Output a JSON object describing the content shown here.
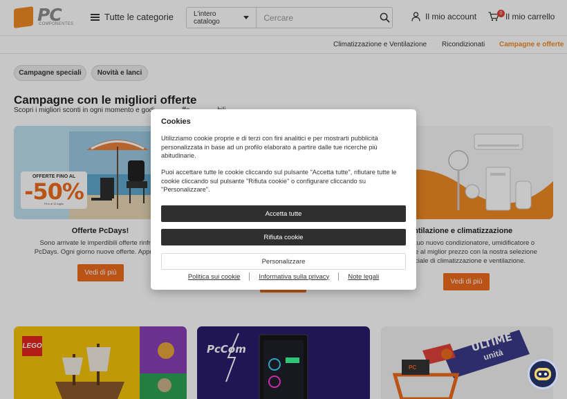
{
  "header": {
    "logo_text": "PC",
    "logo_sub": "COMPONENTES",
    "categories_label": "Tutte le categorie",
    "search": {
      "scope": "L'intero catalogo",
      "placeholder": "Cercare"
    },
    "account_label": "Il mio account",
    "cart_label": "Il mio carrello",
    "cart_count": "0"
  },
  "subnav": {
    "items": [
      {
        "label": "Climatizzazione e Ventilazione"
      },
      {
        "label": "Ricondizionati"
      },
      {
        "label": "Campagne e offerte"
      }
    ]
  },
  "chips": [
    {
      "label": "Campagne speciali"
    },
    {
      "label": "Novità e lanci"
    }
  ],
  "main": {
    "title": "Campagne con le migliori offerte",
    "subtitle": "Scopri i migliori sconti in ogni momento e godi",
    "subtitle_tail": "ffe",
    "subtitle_end": "bili"
  },
  "cards": [
    {
      "promo_line1": "OFFERTE FINO AL",
      "promo_line2": "-50%",
      "promo_note": "Fino al 12 luglio",
      "title": "Offerte PcDays!",
      "desc1": "Sono arrivate le imperdibili offerte rinfresc",
      "desc2": "PcDays. Ogni giorno nuove offerte. Approfitta",
      "button": "Vedi di più"
    },
    {
      "title": "entilazione e climatizzazione",
      "desc1": "tuo nuovo condizionatore, umidificatore o",
      "desc2": "e al miglior prezzo con la nostra selezione",
      "desc3": "ciale di climatizzazione e ventilazione.",
      "button": "Vedi di più"
    }
  ],
  "bottom_cards": [
    {
      "brand": "LEGO"
    },
    {
      "brand": "PcCom"
    },
    {
      "badge_line1": "ULTIME",
      "badge_line2": "unità",
      "box_label": "PC"
    }
  ],
  "cookie_modal": {
    "title": "Cookies",
    "paragraph1": "Utilizziamo cookie proprie e di terzi con fini analitici e per mostrarti pubblicità personalizzata in base ad un profilo elaborato a partire dalle tue ricerche più abitudinarie.",
    "paragraph2": "Puoi accettare tutte le cookie cliccando sul pulsante \"Accetta tutte\", rifiutare tutte le cookie cliccando sul pulsante \"Rifiuta cookie\" o configurare cliccando su \"Personalizzare\".",
    "accept": "Accetta tutte",
    "reject": "Rifiuta cookie",
    "customize": "Personalizzare",
    "links": [
      "Politica sui cookie",
      "Informativa sulla privacy",
      "Note legali"
    ]
  },
  "colors": {
    "accent": "#ef6b1d",
    "dark_button": "#2f2f2f",
    "logo_orange": "#f08a24"
  }
}
